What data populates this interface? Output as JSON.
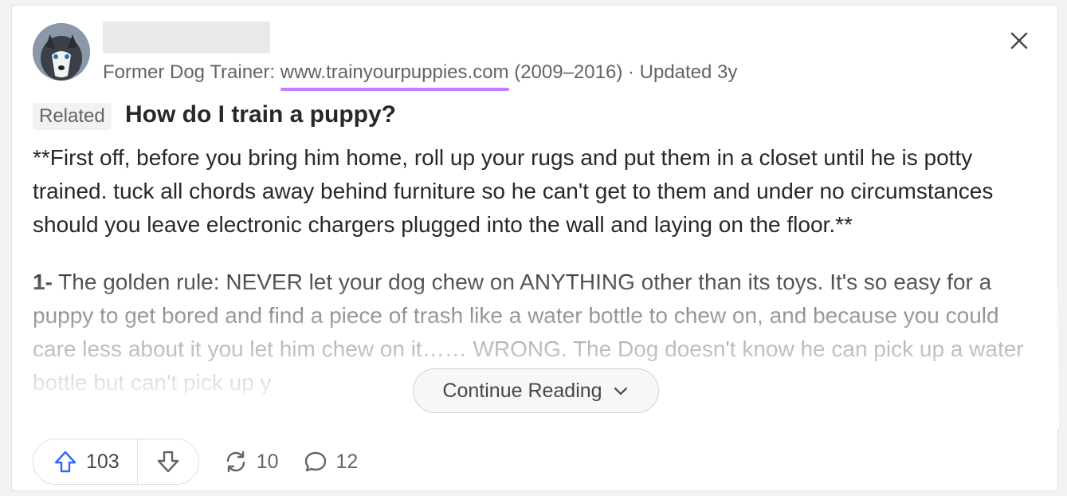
{
  "answer": {
    "credential_prefix": "Former Dog Trainer: ",
    "credential_link": "www.trainyourpuppies.com",
    "credential_suffix": " (2009–2016) · Updated 3y",
    "related_label": "Related",
    "question": "How do I train a puppy?",
    "paragraph1": "**First off, before you bring him home, roll up your rugs and put them in a closet until he is potty trained. tuck all chords away behind furniture so he can't get to them and under no circumstances should you leave electronic chargers plugged into the wall and laying on the floor.**",
    "paragraph2_bold": "1-",
    "paragraph2": " The golden rule: NEVER let your dog chew on ANYTHING other than its toys. It's so easy for a puppy to get bored and find a piece of trash like a water bottle to chew on, and because you could care less about it you let him chew on it…… WRONG. The Dog doesn't know he can pick up a water bottle but can't pick up y",
    "continue_label": "Continue Reading"
  },
  "actions": {
    "upvotes": "103",
    "shares": "10",
    "comments": "12"
  },
  "colors": {
    "accent_upvote": "#2e69ff",
    "link_underline": "#c77dff"
  },
  "icons": [
    "close-icon",
    "upvote-arrow-icon",
    "downvote-arrow-icon",
    "share-icon",
    "comment-icon",
    "chevron-down-icon"
  ]
}
